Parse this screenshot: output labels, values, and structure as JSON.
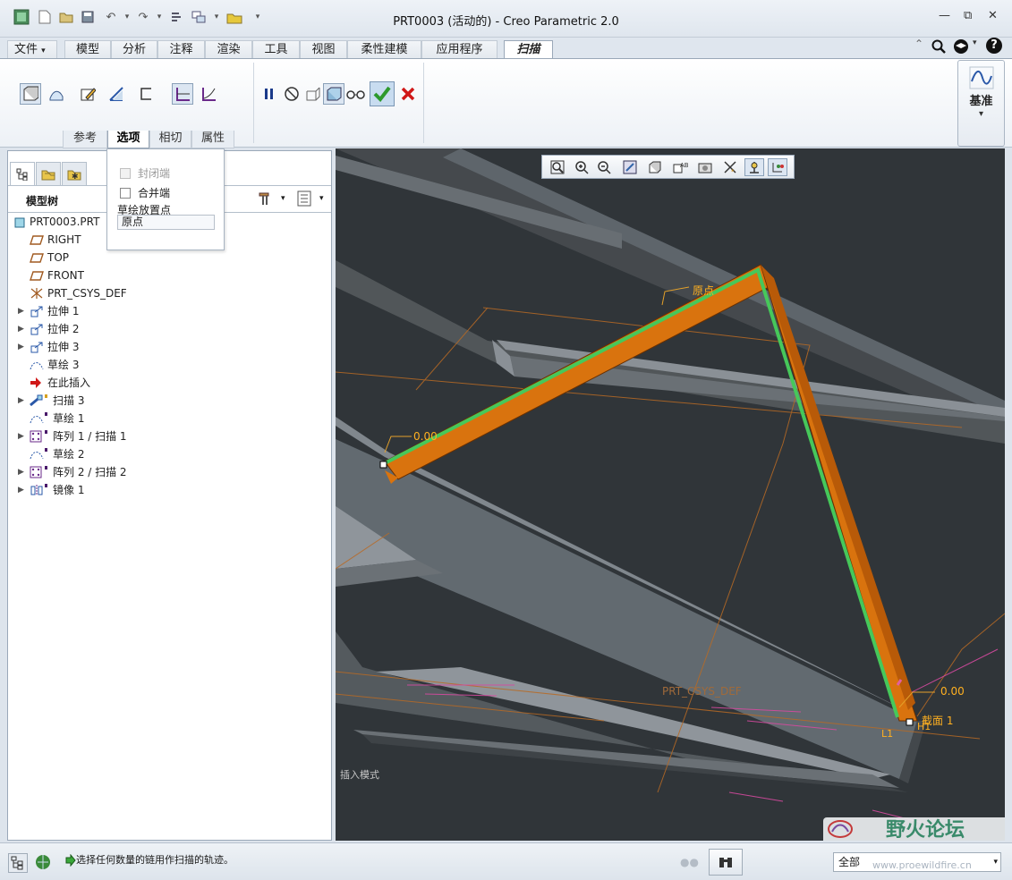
{
  "window": {
    "title": "PRT0003 (活动的) - Creo Parametric 2.0",
    "min_glyph": "—",
    "max_glyph": "⧉",
    "close_glyph": "✕"
  },
  "tabs": [
    "文件",
    "模型",
    "分析",
    "注释",
    "渲染",
    "工具",
    "视图",
    "柔性建模",
    "应用程序",
    "扫描"
  ],
  "file_menu_arrow": "▾",
  "help_glyph": "?",
  "ribbon": {
    "subtabs": [
      "参考",
      "选项",
      "相切",
      "属性"
    ],
    "datum_label": "基准",
    "datum_arrow": "▾"
  },
  "options_popup": {
    "seal_ends_label": "封闭端",
    "merge_ends_label": "合并端",
    "sketch_placement_label": "草绘放置点",
    "sketch_placement_value": "原点"
  },
  "model_tree": {
    "title": "模型树",
    "items": [
      {
        "label": "PRT0003.PRT",
        "icon": "part-icon"
      },
      {
        "label": "RIGHT",
        "icon": "datum-plane-icon"
      },
      {
        "label": "TOP",
        "icon": "datum-plane-icon"
      },
      {
        "label": "FRONT",
        "icon": "datum-plane-icon"
      },
      {
        "label": "PRT_CSYS_DEF",
        "icon": "csys-icon"
      },
      {
        "label": "拉伸 1",
        "icon": "extrude-icon"
      },
      {
        "label": "拉伸 2",
        "icon": "extrude-icon"
      },
      {
        "label": "拉伸 3",
        "icon": "extrude-icon"
      },
      {
        "label": "草绘 3",
        "icon": "sketch-icon"
      },
      {
        "label": "在此插入",
        "icon": "insert-here-icon"
      },
      {
        "label": "扫描 3",
        "icon": "sweep-icon"
      },
      {
        "label": "草绘 1",
        "icon": "sketch-icon"
      },
      {
        "label": "阵列 1 / 扫描 1",
        "icon": "pattern-icon"
      },
      {
        "label": "草绘 2",
        "icon": "sketch-icon"
      },
      {
        "label": "阵列 2 / 扫描 2",
        "icon": "pattern-icon"
      },
      {
        "label": "镜像 1",
        "icon": "mirror-icon"
      }
    ]
  },
  "viewport": {
    "origin_label": "原点",
    "dim_start": "0.00",
    "dim_end": "0.00",
    "section_label": "截面 1",
    "csys_label": "PRT_CSYS_DEF",
    "mode_text": "插入模式",
    "h1_label": "H1",
    "l1_label": "L1"
  },
  "status": {
    "message": "选择任何数量的链用作扫描的轨迹。",
    "filter_value": "全部",
    "filter_arrow": "▾",
    "watermark_title": "野火论坛",
    "watermark_url": "www.proewildfire.cn"
  },
  "colors": {
    "accent_orange": "#e07a10",
    "trajectory_green": "#46c85a",
    "viewport_bg": "#303539",
    "ok_green": "#2d9a2d",
    "cancel_red": "#d01818"
  }
}
